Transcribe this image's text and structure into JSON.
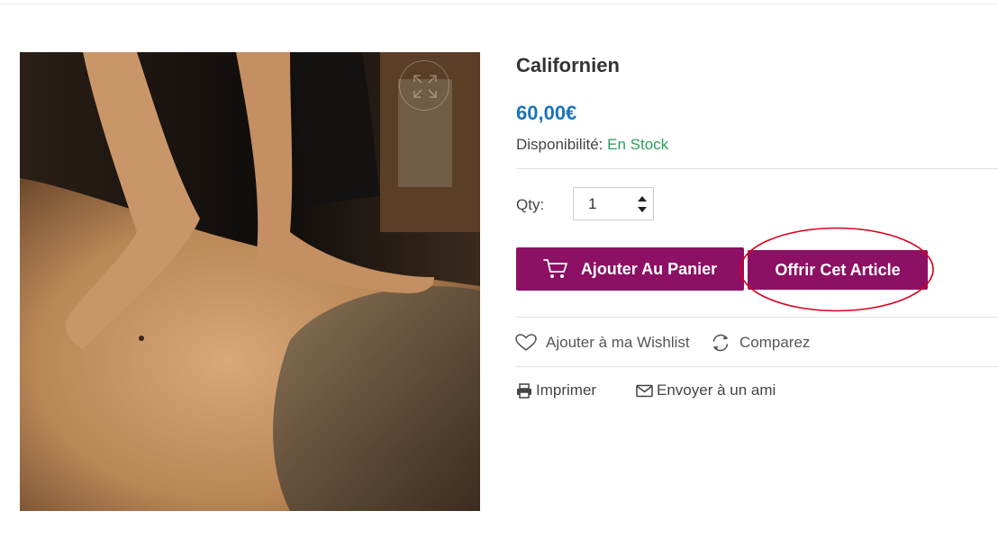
{
  "product": {
    "title": "Californien",
    "price": "60,00€",
    "availability_label": "Disponibilité:",
    "availability_value": "En Stock",
    "image_alt": "massage-photo"
  },
  "quantity": {
    "label": "Qty:",
    "value": "1"
  },
  "buttons": {
    "add_to_cart": "Ajouter Au Panier",
    "gift": "Offrir Cet Article"
  },
  "links": {
    "wishlist": "Ajouter à ma Wishlist",
    "compare": "Comparez",
    "print": "Imprimer",
    "email_friend": "Envoyer à un ami"
  },
  "icons": {
    "zoom": "expand-icon",
    "cart": "cart-icon",
    "wishlist": "heart-icon",
    "compare": "refresh-icon",
    "print": "printer-icon",
    "email": "envelope-icon",
    "qty": "stepper-arrows-icon"
  },
  "colors": {
    "accent": "#8c1064",
    "price": "#1b75bb",
    "in_stock": "#2a9d5b",
    "highlight": "#d9001b"
  }
}
